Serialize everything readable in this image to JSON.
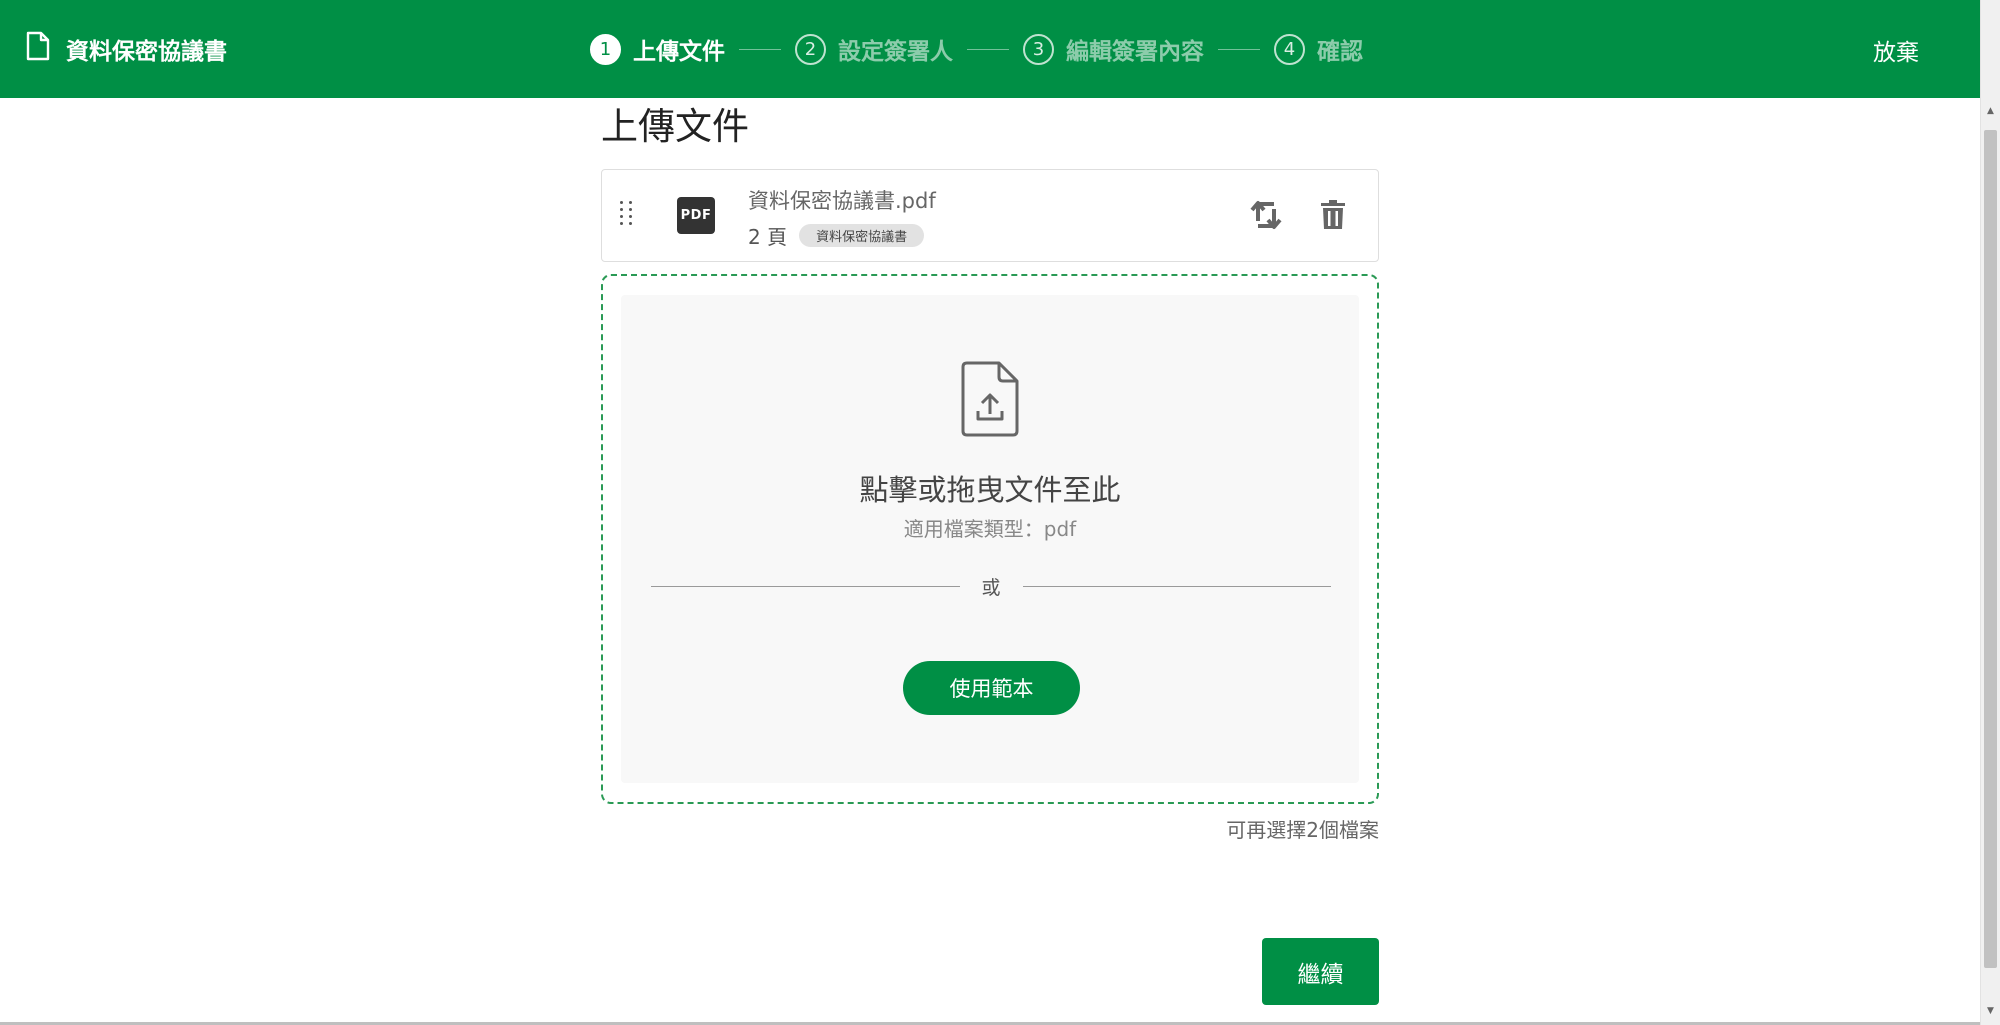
{
  "header": {
    "doc_title": "資料保密協議書",
    "abandon_label": "放棄",
    "steps": [
      {
        "num": "1",
        "label": "上傳文件",
        "active": true
      },
      {
        "num": "2",
        "label": "設定簽署人",
        "active": false
      },
      {
        "num": "3",
        "label": "編輯簽署內容",
        "active": false
      },
      {
        "num": "4",
        "label": "確認",
        "active": false
      }
    ]
  },
  "main": {
    "title": "上傳文件",
    "file": {
      "icon_text": "PDF",
      "name": "資料保密協議書.pdf",
      "pages": "2 頁",
      "tag": "資料保密協議書"
    },
    "dropzone": {
      "title": "點擊或拖曳文件至此",
      "subtitle": "適用檔案類型：pdf",
      "or_label": "或",
      "template_button": "使用範本"
    },
    "remaining_files": "可再選擇2個檔案",
    "continue_button": "繼續"
  },
  "colors": {
    "brand_green": "#008f45",
    "dashed_border": "#2a9a55"
  },
  "icons": [
    "document-icon",
    "drag-handle-icon",
    "pdf-icon",
    "replace-icon",
    "trash-icon",
    "file-upload-icon"
  ]
}
